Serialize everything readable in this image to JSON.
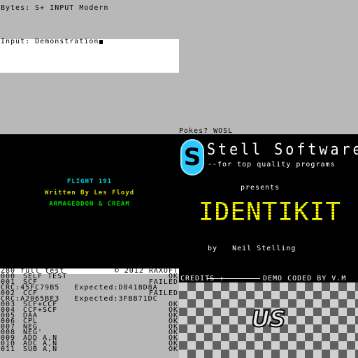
{
  "top": {
    "bytes_line": "Bytes: S+ INPUT Modern",
    "input_line": "Input: Demonstration",
    "pokes_line": "Pokes? WOSL"
  },
  "loading_screen": {
    "left_credits": {
      "title": "FLIGHT 191",
      "written_by": "Written By Les Floyd",
      "music": "ARMAGEDDON & CREAM"
    },
    "logo_letter": "S",
    "company": "Stell Software",
    "tagline": "--for top quality programs",
    "presents": "presents",
    "game_title": "IDENTIKIT",
    "byline": "by   Neil Stelling",
    "colors": {
      "cyan": "#00d7d7",
      "yellow": "#d7d700",
      "green": "#00d700",
      "logo": "#2ec8ff",
      "title": "#ffff00"
    }
  },
  "test_panel": {
    "title": "Z80 full test",
    "copyright": "© 2012 RAXOFT",
    "rows": [
      {
        "num": "000",
        "name": "SELF TEST",
        "result": "OK"
      },
      {
        "num": "001",
        "name": "SCF",
        "result": "FAILED"
      },
      {
        "num": "CRC:",
        "name": "CRC:45FC79B5   Expected:D8418D8A",
        "result": "",
        "crc": true
      },
      {
        "num": "002",
        "name": "CCF",
        "result": "FAILED"
      },
      {
        "num": "CRC:",
        "name": "CRC:A2065BE3   Expected:3FBB71DC",
        "result": "",
        "crc": true
      },
      {
        "num": "003",
        "name": "SCF+CCF",
        "result": "OK"
      },
      {
        "num": "004",
        "name": "CCF+SCF",
        "result": "OK"
      },
      {
        "num": "005",
        "name": "DAA",
        "result": "OK"
      },
      {
        "num": "006",
        "name": "CPL",
        "result": "OK"
      },
      {
        "num": "007",
        "name": "NEG",
        "result": "OK"
      },
      {
        "num": "008",
        "name": "NEG'",
        "result": "OK"
      },
      {
        "num": "009",
        "name": "ADD A,N",
        "result": "OK"
      },
      {
        "num": "010",
        "name": "ADC A,N",
        "result": "OK"
      },
      {
        "num": "011",
        "name": "SUB A,N",
        "result": "OK"
      }
    ]
  },
  "demo_panel": {
    "credits_label": "CREDITS :",
    "credits_text": "DEMO CODED BY V.M",
    "logo_text": "US"
  }
}
